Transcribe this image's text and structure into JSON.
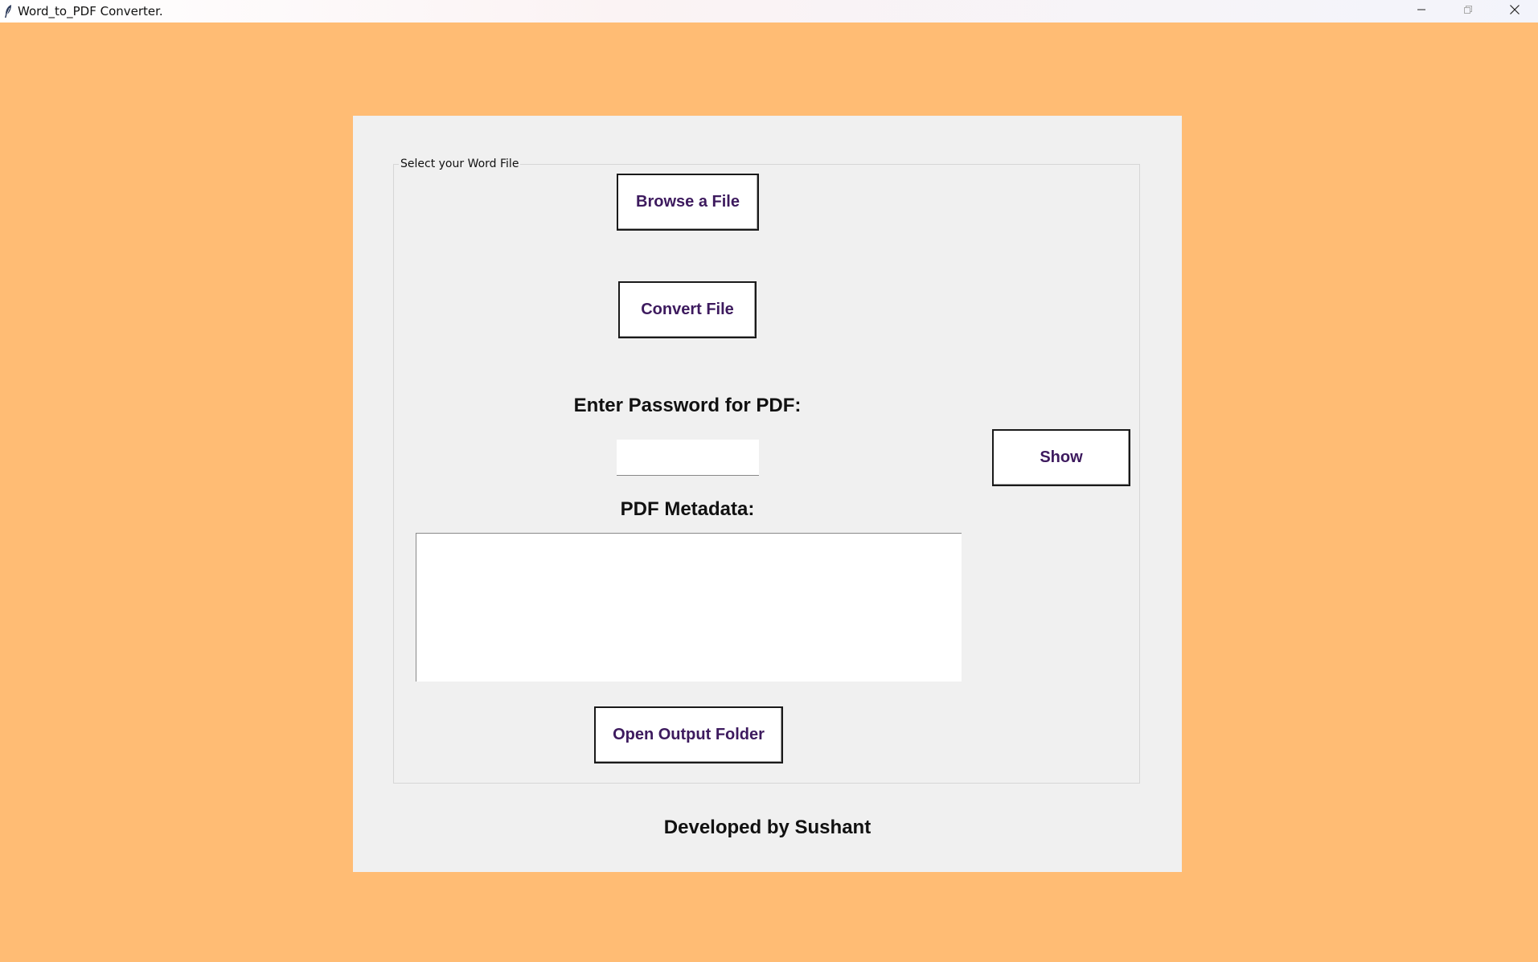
{
  "window": {
    "title": "Word_to_PDF Converter.",
    "controls": [
      "minimize-icon",
      "restore-icon",
      "close-icon"
    ]
  },
  "colors": {
    "background": "#FFBC74",
    "panel": "#F0F0F0",
    "button_text": "#3D1A5E"
  },
  "frame": {
    "caption": "Select your Word File"
  },
  "buttons": {
    "browse": "Browse a File",
    "convert": "Convert File",
    "show": "Show",
    "open_output": "Open Output Folder"
  },
  "password": {
    "label": "Enter Password for PDF:",
    "value": ""
  },
  "metadata": {
    "label": "PDF Metadata:",
    "value": ""
  },
  "footer": {
    "credit": "Developed by Sushant"
  }
}
